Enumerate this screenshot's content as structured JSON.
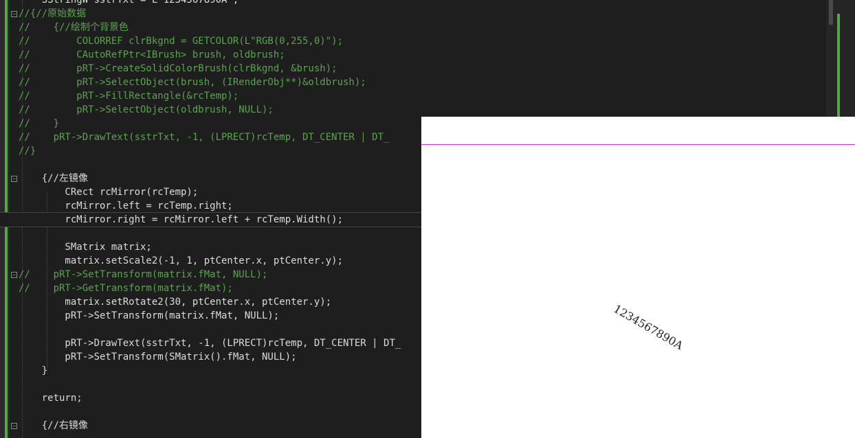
{
  "editor": {
    "lines": [
      {
        "prefix": "",
        "text": "    SStringW sstrTxt = L\"1234567890A\";"
      },
      {
        "prefix": "//",
        "text": "  {//原始数据"
      },
      {
        "prefix": "//",
        "text": "      {//绘制个背景色"
      },
      {
        "prefix": "//",
        "text": "          COLORREF clrBkgnd = GETCOLOR(L\"RGB(0,255,0)\");"
      },
      {
        "prefix": "//",
        "text": "          CAutoRefPtr<IBrush> brush, oldbrush;"
      },
      {
        "prefix": "//",
        "text": "          pRT->CreateSolidColorBrush(clrBkgnd, &brush);"
      },
      {
        "prefix": "//",
        "text": "          pRT->SelectObject(brush, (IRenderObj**)&oldbrush);"
      },
      {
        "prefix": "//",
        "text": "          pRT->FillRectangle(&rcTemp);"
      },
      {
        "prefix": "//",
        "text": "          pRT->SelectObject(oldbrush, NULL);"
      },
      {
        "prefix": "//",
        "text": "      }"
      },
      {
        "prefix": "//",
        "text": "      pRT->DrawText(sstrTxt, -1, (LPRECT)rcTemp, DT_CENTER | DT_"
      },
      {
        "prefix": "//",
        "text": "  }"
      },
      {
        "prefix": "",
        "text": ""
      },
      {
        "prefix": "",
        "text": "    {//左镜像"
      },
      {
        "prefix": "",
        "text": "        CRect rcMirror(rcTemp);"
      },
      {
        "prefix": "",
        "text": "        rcMirror.left = rcTemp.right;"
      },
      {
        "prefix": "",
        "text": "        rcMirror.right = rcMirror.left + rcTemp.Width();"
      },
      {
        "prefix": "",
        "text": ""
      },
      {
        "prefix": "",
        "text": "        SMatrix matrix;"
      },
      {
        "prefix": "",
        "text": "        matrix.setScale2(-1, 1, ptCenter.x, ptCenter.y);"
      },
      {
        "prefix": "//",
        "text": "      pRT->SetTransform(matrix.fMat, NULL);"
      },
      {
        "prefix": "//",
        "text": "      pRT->GetTransform(matrix.fMat);"
      },
      {
        "prefix": "",
        "text": "        matrix.setRotate2(30, ptCenter.x, ptCenter.y);"
      },
      {
        "prefix": "",
        "text": "        pRT->SetTransform(matrix.fMat, NULL);"
      },
      {
        "prefix": "",
        "text": ""
      },
      {
        "prefix": "",
        "text": "        pRT->DrawText(sstrTxt, -1, (LPRECT)rcTemp, DT_CENTER | DT_"
      },
      {
        "prefix": "",
        "text": "        pRT->SetTransform(SMatrix().fMat, NULL);"
      },
      {
        "prefix": "",
        "text": "    }"
      },
      {
        "prefix": "",
        "text": ""
      },
      {
        "prefix": "",
        "text": "    return;"
      },
      {
        "prefix": "",
        "text": ""
      },
      {
        "prefix": "",
        "text": "    {//右镜像"
      }
    ]
  },
  "render_window": {
    "text": "1234567890A",
    "line_color": "#c43bc4",
    "background": "#ffffff"
  },
  "colors": {
    "comment": "#57a64a",
    "type": "#e6db74",
    "function": "#ff8c42",
    "macro": "#b267e6",
    "text": "#dcdcdc"
  }
}
